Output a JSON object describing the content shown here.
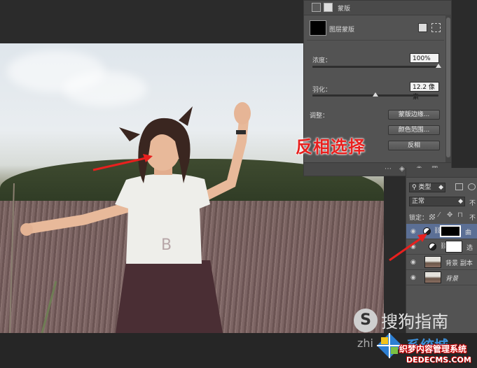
{
  "masks_panel": {
    "title": "蒙版",
    "layer_mask_label": "图层蒙版",
    "density_label": "浓度：",
    "density_value": "100%",
    "density_level": 1.0,
    "feather_label": "羽化：",
    "feather_value": "12.2 像素",
    "feather_level": 0.5,
    "refine_label": "调整：",
    "buttons": [
      "蒙版边缘...",
      "颜色范围...",
      "反相"
    ]
  },
  "layers_panel": {
    "kind_filter": "类型",
    "blend_mode": "正常",
    "opacity_label_partial": "不",
    "lock_label": "锁定：",
    "layers": [
      {
        "name": "曲",
        "selected": true
      },
      {
        "name": "选",
        "selected": false
      },
      {
        "name": "背景 副本",
        "selected": false
      },
      {
        "name": "背景",
        "selected": false
      }
    ]
  },
  "callout": {
    "text": "反相选择",
    "color": "#e8201e"
  },
  "watermarks": {
    "sogou": "搜狗指南",
    "sogou_url_partial": "zhi",
    "xitong": "系统城",
    "dedecms_title": "织梦内容管理系统",
    "dedecms_url": "DEDECMS.COM"
  },
  "colors": {
    "arrow": "#e8201e",
    "panel_bg": "#535353",
    "workspace": "#2b2b2b",
    "selected_row": "#5b6f95"
  }
}
